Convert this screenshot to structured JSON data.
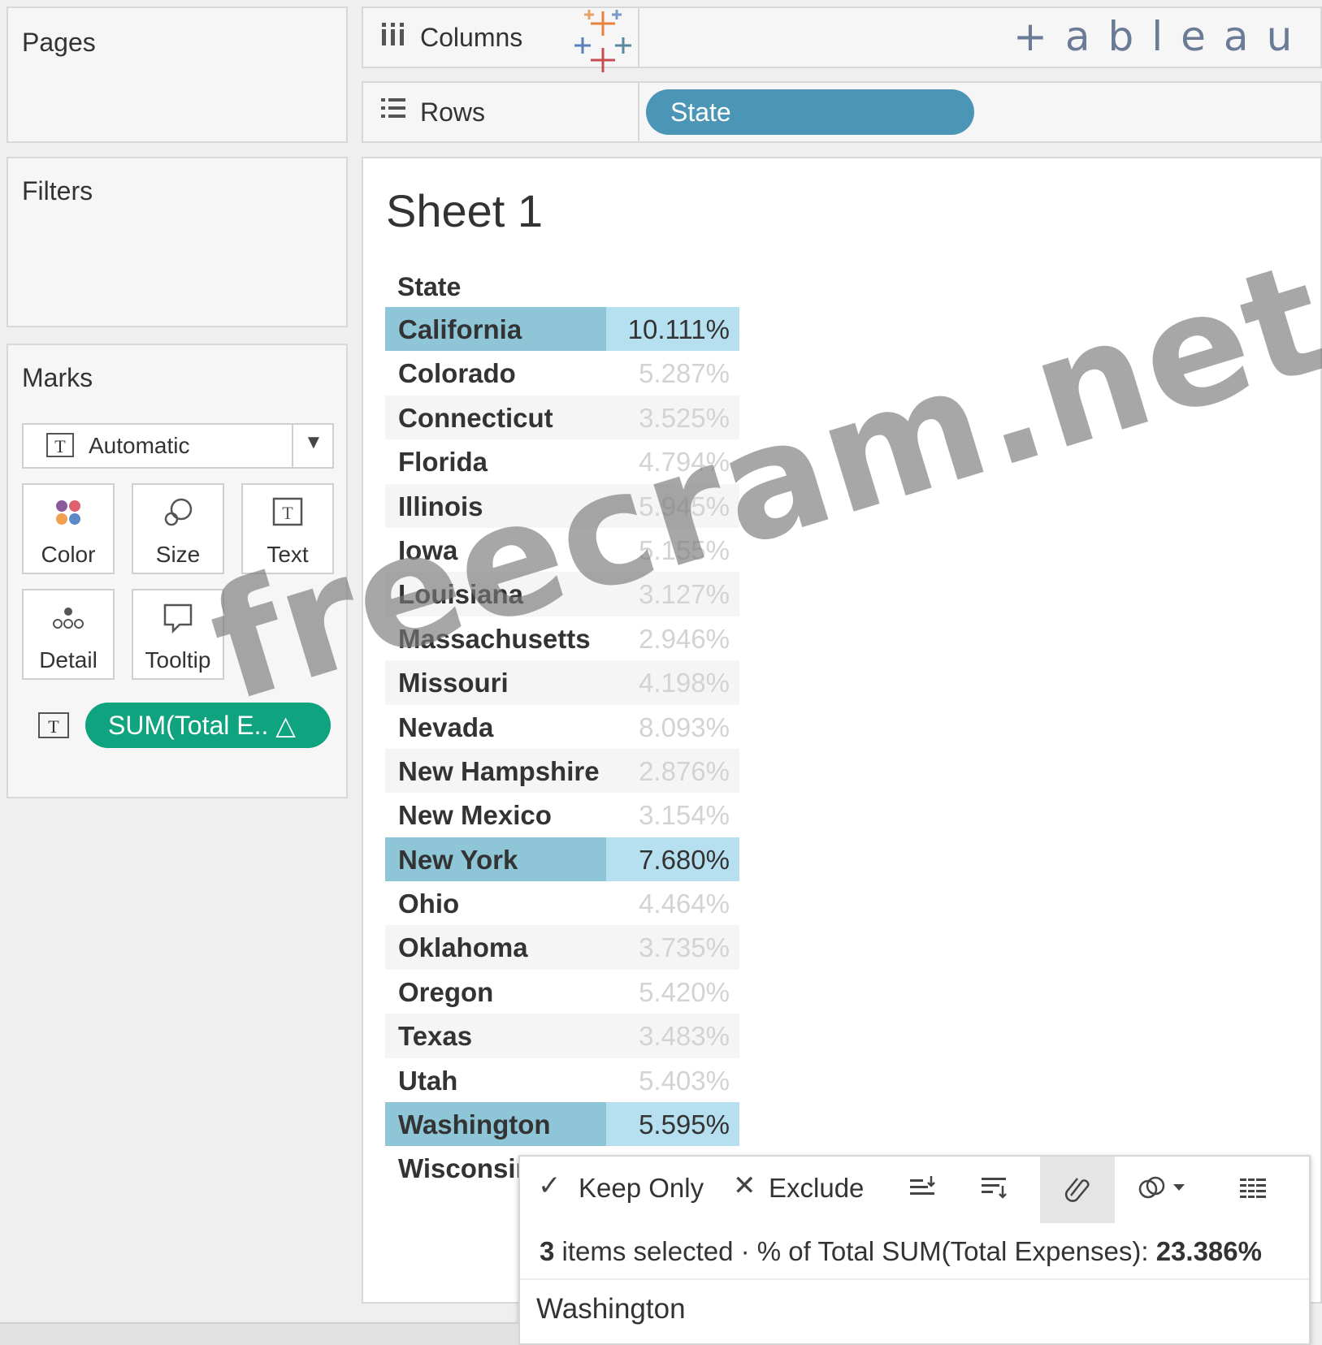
{
  "shelves": {
    "columns_label": "Columns",
    "rows_label": "Rows",
    "rows_pill": "State",
    "logo_text": "+ableau"
  },
  "panels": {
    "pages_title": "Pages",
    "filters_title": "Filters",
    "marks_title": "Marks"
  },
  "marks": {
    "type_label": "Automatic",
    "color_label": "Color",
    "size_label": "Size",
    "text_label": "Text",
    "detail_label": "Detail",
    "tooltip_label": "Tooltip",
    "measure_pill": "SUM(Total E.. △"
  },
  "sheet": {
    "title": "Sheet 1",
    "column_header": "State",
    "rows": [
      {
        "state": "California",
        "value": "10.111%",
        "selected": true
      },
      {
        "state": "Colorado",
        "value": "5.287%",
        "selected": false
      },
      {
        "state": "Connecticut",
        "value": "3.525%",
        "selected": false
      },
      {
        "state": "Florida",
        "value": "4.794%",
        "selected": false
      },
      {
        "state": "Illinois",
        "value": "5.945%",
        "selected": false
      },
      {
        "state": "Iowa",
        "value": "5.155%",
        "selected": false
      },
      {
        "state": "Louisiana",
        "value": "3.127%",
        "selected": false
      },
      {
        "state": "Massachusetts",
        "value": "2.946%",
        "selected": false
      },
      {
        "state": "Missouri",
        "value": "4.198%",
        "selected": false
      },
      {
        "state": "Nevada",
        "value": "8.093%",
        "selected": false
      },
      {
        "state": "New Hampshire",
        "value": "2.876%",
        "selected": false
      },
      {
        "state": "New Mexico",
        "value": "3.154%",
        "selected": false
      },
      {
        "state": "New York",
        "value": "7.680%",
        "selected": true
      },
      {
        "state": "Ohio",
        "value": "4.464%",
        "selected": false
      },
      {
        "state": "Oklahoma",
        "value": "3.735%",
        "selected": false
      },
      {
        "state": "Oregon",
        "value": "5.420%",
        "selected": false
      },
      {
        "state": "Texas",
        "value": "3.483%",
        "selected": false
      },
      {
        "state": "Utah",
        "value": "5.403%",
        "selected": false
      },
      {
        "state": "Washington",
        "value": "5.595%",
        "selected": true
      },
      {
        "state": "Wisconsin",
        "value": "",
        "selected": false
      }
    ]
  },
  "tooltip": {
    "keep_only": "Keep Only",
    "exclude": "Exclude",
    "selected_count": "3",
    "selected_text": " items selected  ·  % of Total SUM(Total Expenses): ",
    "selected_total": "23.386%",
    "hover_name": "Washington"
  },
  "watermark": "freecram.net",
  "colors": {
    "selected_row": "#8ec6d8",
    "selected_value": "#b6e0f0",
    "rows_pill": "#4b96b6",
    "measure_pill": "#10a37f"
  }
}
